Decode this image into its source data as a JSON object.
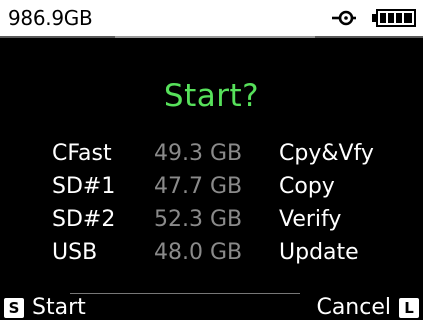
{
  "status_bar": {
    "free_space": "986.9GB",
    "power_icon": "dc-power-plug-icon",
    "battery_icon": "battery-full-icon"
  },
  "dialog": {
    "title": "Start?",
    "title_color": "#57e15b",
    "devices": [
      {
        "name": "CFast",
        "size": "49.3 GB",
        "mode": "Cpy&Vfy"
      },
      {
        "name": "SD#1",
        "size": "47.7 GB",
        "mode": "Copy"
      },
      {
        "name": "SD#2",
        "size": "52.3 GB",
        "mode": "Verify"
      },
      {
        "name": "USB",
        "size": "48.0 GB",
        "mode": "Update"
      }
    ]
  },
  "softkeys": {
    "left": {
      "key": "S",
      "label": "Start"
    },
    "right": {
      "key": "L",
      "label": "Cancel"
    }
  }
}
